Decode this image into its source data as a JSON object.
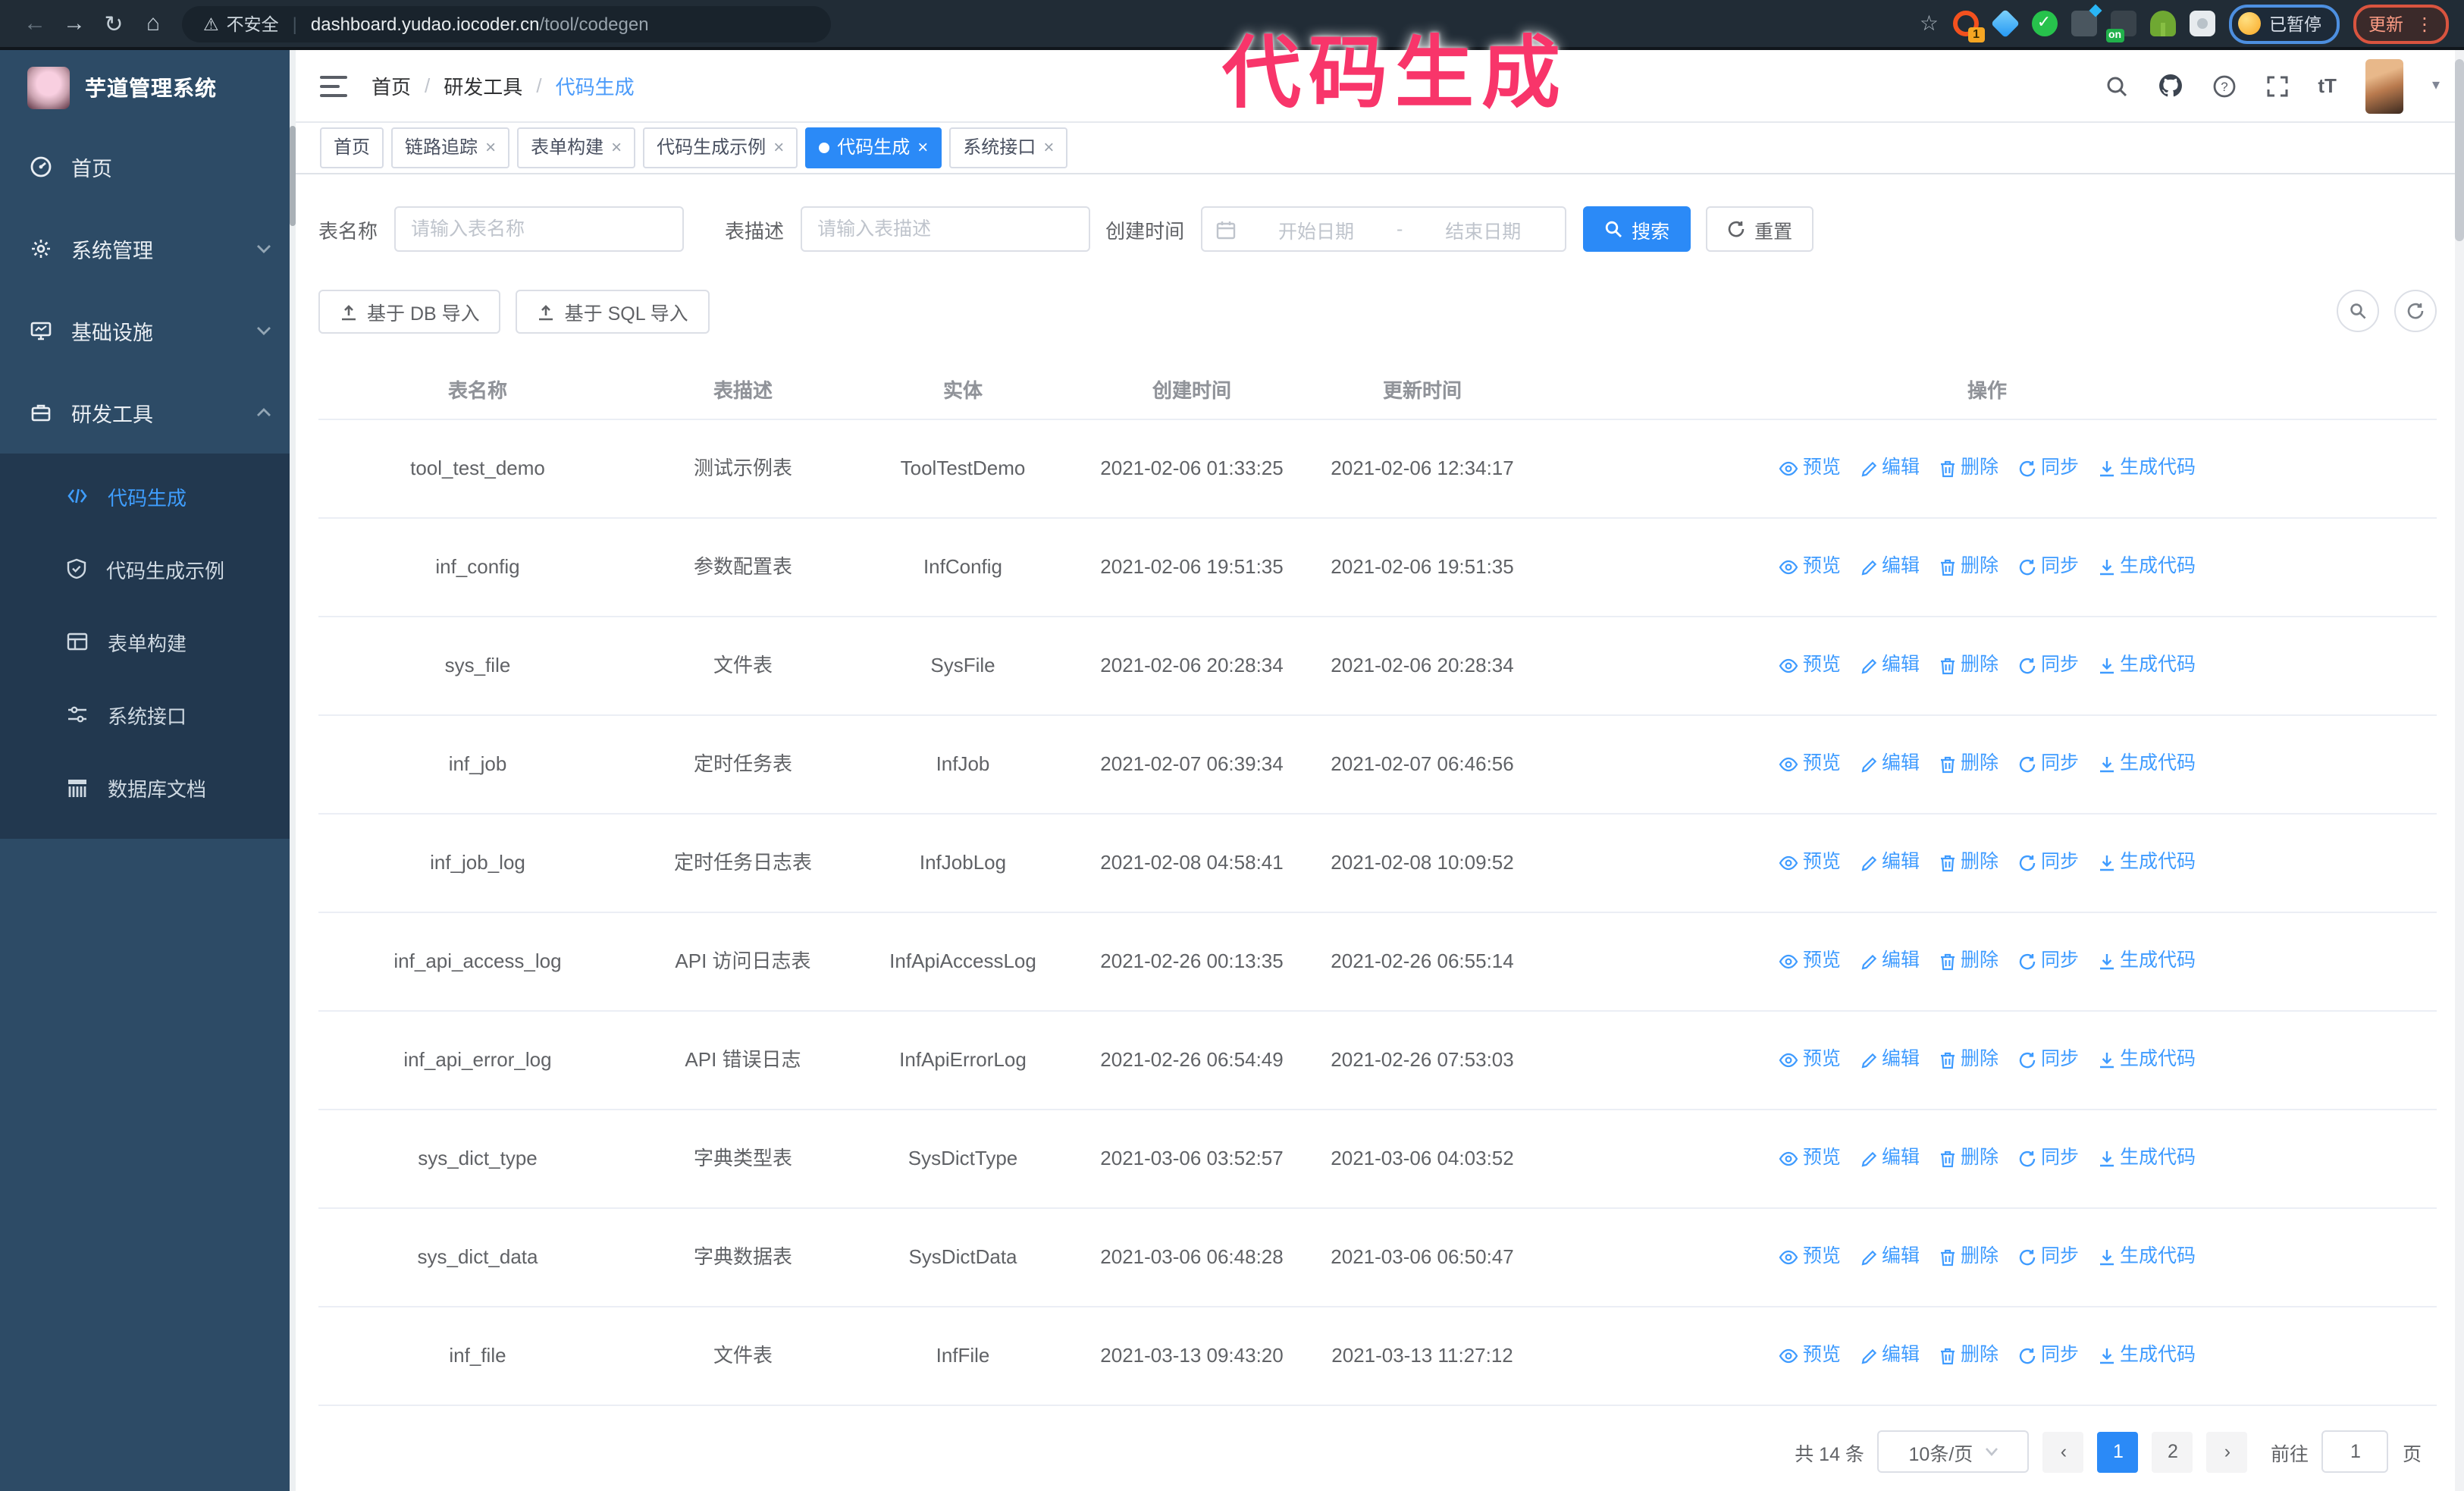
{
  "annotation": {
    "text": "代码生成"
  },
  "icons": {
    "back": "←",
    "forward": "→",
    "reload": "↻",
    "home": "⌂",
    "warning": "⚠",
    "star": "☆",
    "kebab": "⋮",
    "caret_down": "▾",
    "font_size": "tT",
    "close": "×",
    "chev_left": "‹",
    "chev_right": "›",
    "range_dash": "-"
  },
  "browser": {
    "security_warning": "不安全",
    "url_host": "dashboard.yudao.iocoder.cn",
    "url_path": "/tool/codegen",
    "extension_badge": "1",
    "extension_on_badge": "on",
    "paused_chip": "已暂停",
    "update_button": "更新"
  },
  "sidebar": {
    "logo_title": "芋道管理系统",
    "menu": [
      {
        "label": "首页"
      },
      {
        "label": "系统管理"
      },
      {
        "label": "基础设施"
      },
      {
        "label": "研发工具"
      }
    ],
    "submenu": [
      {
        "label": "代码生成",
        "active": true
      },
      {
        "label": "代码生成示例"
      },
      {
        "label": "表单构建"
      },
      {
        "label": "系统接口"
      },
      {
        "label": "数据库文档"
      }
    ]
  },
  "header": {
    "breadcrumb": [
      "首页",
      "研发工具",
      "代码生成"
    ]
  },
  "tabs": [
    {
      "label": "首页",
      "closable": false
    },
    {
      "label": "链路追踪",
      "closable": true
    },
    {
      "label": "表单构建",
      "closable": true
    },
    {
      "label": "代码生成示例",
      "closable": true
    },
    {
      "label": "代码生成",
      "closable": true,
      "active": true
    },
    {
      "label": "系统接口",
      "closable": true
    }
  ],
  "filters": {
    "table_name_label": "表名称",
    "table_name_placeholder": "请输入表名称",
    "table_desc_label": "表描述",
    "table_desc_placeholder": "请输入表描述",
    "create_time_label": "创建时间",
    "start_placeholder": "开始日期",
    "end_placeholder": "结束日期",
    "search_label": "搜索",
    "reset_label": "重置"
  },
  "toolbar": {
    "import_db_label": "基于 DB 导入",
    "import_sql_label": "基于 SQL 导入"
  },
  "table": {
    "columns": [
      "表名称",
      "表描述",
      "实体",
      "创建时间",
      "更新时间",
      "操作"
    ],
    "actions": [
      "预览",
      "编辑",
      "删除",
      "同步",
      "生成代码"
    ],
    "rows": [
      {
        "name": "tool_test_demo",
        "desc": "测试示例表",
        "entity": "ToolTestDemo",
        "created": "2021-02-06 01:33:25",
        "updated": "2021-02-06 12:34:17"
      },
      {
        "name": "inf_config",
        "desc": "参数配置表",
        "entity": "InfConfig",
        "created": "2021-02-06 19:51:35",
        "updated": "2021-02-06 19:51:35"
      },
      {
        "name": "sys_file",
        "desc": "文件表",
        "entity": "SysFile",
        "created": "2021-02-06 20:28:34",
        "updated": "2021-02-06 20:28:34"
      },
      {
        "name": "inf_job",
        "desc": "定时任务表",
        "entity": "InfJob",
        "created": "2021-02-07 06:39:34",
        "updated": "2021-02-07 06:46:56"
      },
      {
        "name": "inf_job_log",
        "desc": "定时任务日志表",
        "entity": "InfJobLog",
        "created": "2021-02-08 04:58:41",
        "updated": "2021-02-08 10:09:52"
      },
      {
        "name": "inf_api_access_log",
        "desc": "API 访问日志表",
        "entity": "InfApiAccessLog",
        "created": "2021-02-26 00:13:35",
        "updated": "2021-02-26 06:55:14"
      },
      {
        "name": "inf_api_error_log",
        "desc": "API 错误日志",
        "entity": "InfApiErrorLog",
        "created": "2021-02-26 06:54:49",
        "updated": "2021-02-26 07:53:03"
      },
      {
        "name": "sys_dict_type",
        "desc": "字典类型表",
        "entity": "SysDictType",
        "created": "2021-03-06 03:52:57",
        "updated": "2021-03-06 04:03:52"
      },
      {
        "name": "sys_dict_data",
        "desc": "字典数据表",
        "entity": "SysDictData",
        "created": "2021-03-06 06:48:28",
        "updated": "2021-03-06 06:50:47"
      },
      {
        "name": "inf_file",
        "desc": "文件表",
        "entity": "InfFile",
        "created": "2021-03-13 09:43:20",
        "updated": "2021-03-13 11:27:12"
      }
    ]
  },
  "pagination": {
    "total": "共 14 条",
    "page_size": "10条/页",
    "page_1": "1",
    "page_2": "2",
    "goto_label": "前往",
    "goto_value": "1",
    "goto_suffix": "页"
  }
}
